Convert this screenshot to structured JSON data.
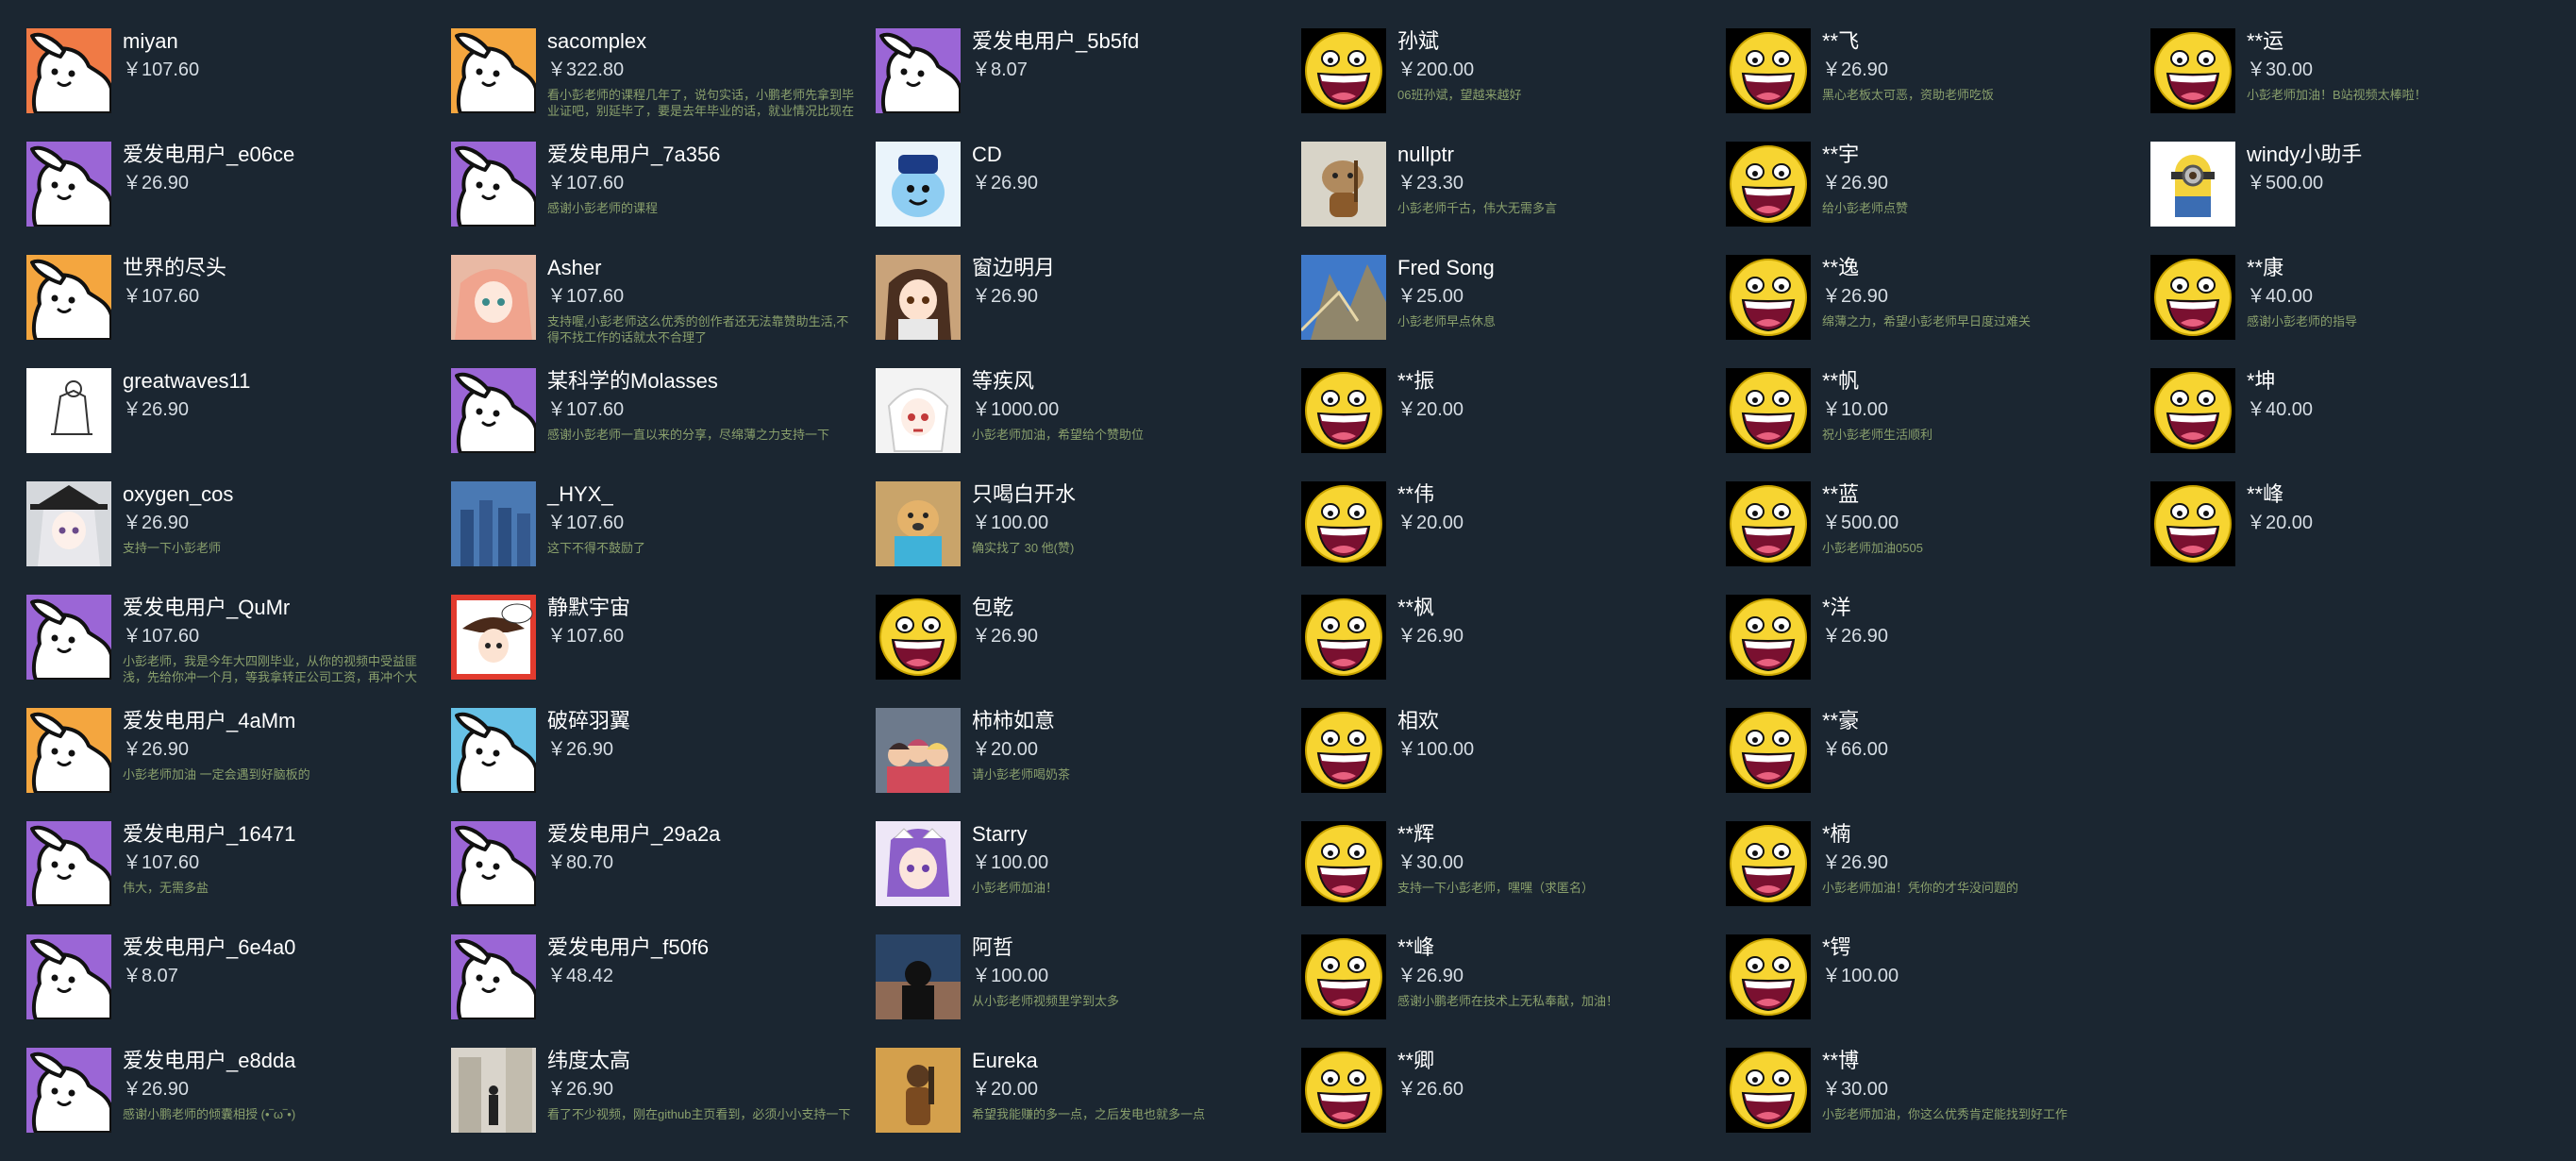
{
  "colors": {
    "background": "#1b2631",
    "name": "#ffffff",
    "amount": "#d6dde4",
    "message": "#8aa06c",
    "bunny_purple": "#9b66d6",
    "bunny_orange": "#f4a63f",
    "bunny_coral": "#f07a45",
    "bunny_sky": "#67c1e6",
    "smiley_yellow": "#f7d531"
  },
  "columns": [
    [
      {
        "name": "miyan",
        "amount": "￥107.60",
        "message": "",
        "avatar": "bunny-icon",
        "bg": "#f07a45"
      },
      {
        "name": "爱发电用户_e06ce",
        "amount": "￥26.90",
        "message": "",
        "avatar": "bunny-icon",
        "bg": "#9b66d6"
      },
      {
        "name": "世界的尽头",
        "amount": "￥107.60",
        "message": "",
        "avatar": "bunny-icon",
        "bg": "#f4a63f"
      },
      {
        "name": "greatwaves11",
        "amount": "￥26.90",
        "message": "",
        "avatar": "sketch-photo",
        "bg": "#ffffff"
      },
      {
        "name": "oxygen_cos",
        "amount": "￥26.90",
        "message": "支持一下小彭老师",
        "avatar": "anime-girl-photo",
        "bg": "#d5d8dc"
      },
      {
        "name": "爱发电用户_QuMr",
        "amount": "￥107.60",
        "message": "小彭老师，我是今年大四刚毕业，从你的视频中受益匪浅，先给你冲一个月，等我拿转正公司工资，再冲个大的！",
        "avatar": "bunny-icon",
        "bg": "#9b66d6"
      },
      {
        "name": "爱发电用户_4aMm",
        "amount": "￥26.90",
        "message": "小彭老师加油 一定会遇到好脑板的 ",
        "avatar": "bunny-icon",
        "bg": "#f4a63f"
      },
      {
        "name": "爱发电用户_16471",
        "amount": "￥107.60",
        "message": "伟大，无需多盐",
        "avatar": "bunny-icon",
        "bg": "#9b66d6"
      },
      {
        "name": "爱发电用户_6e4a0",
        "amount": "￥8.07",
        "message": "",
        "avatar": "bunny-icon",
        "bg": "#9b66d6"
      },
      {
        "name": "爱发电用户_e8dda",
        "amount": "￥26.90",
        "message": "感谢小鹏老师的倾囊相授 (•‾ω‾•)",
        "avatar": "bunny-icon",
        "bg": "#9b66d6"
      }
    ],
    [
      {
        "name": "sacomplex",
        "amount": "￥322.80",
        "message": "看小彭老师的课程几年了，说句实话，小鹏老师先拿到毕业证吧，别延毕了，要是去年毕业的话，就业情况比现在好很多了",
        "avatar": "bunny-icon",
        "bg": "#f4a63f"
      },
      {
        "name": "爱发电用户_7a356",
        "amount": "￥107.60",
        "message": "感谢小彭老师的课程",
        "avatar": "bunny-icon",
        "bg": "#9b66d6"
      },
      {
        "name": "Asher",
        "amount": "￥107.60",
        "message": "支持喔,小彭老师这么优秀的创作者还无法靠赞助生活,不得不找工作的话就太不合理了",
        "avatar": "anime-pink-photo",
        "bg": "#e9b9a4"
      },
      {
        "name": "某科学的Molasses",
        "amount": "￥107.60",
        "message": "感谢小彭老师一直以来的分享，尽绵薄之力支持一下",
        "avatar": "bunny-icon",
        "bg": "#9b66d6"
      },
      {
        "name": "_HYX_",
        "amount": "￥107.60",
        "message": "这下不得不鼓励了",
        "avatar": "blue-figures-photo",
        "bg": "#4a79b3"
      },
      {
        "name": "静默宇宙",
        "amount": "￥107.60",
        "message": "",
        "avatar": "girl-hat-photo",
        "bg": "#e23b2e"
      },
      {
        "name": "破碎羽翼",
        "amount": "￥26.90",
        "message": "",
        "avatar": "bunny-icon",
        "bg": "#67c1e6"
      },
      {
        "name": "爱发电用户_29a2a",
        "amount": "￥80.70",
        "message": "",
        "avatar": "bunny-icon",
        "bg": "#9b66d6"
      },
      {
        "name": "爱发电用户_f50f6",
        "amount": "￥48.42",
        "message": "",
        "avatar": "bunny-icon",
        "bg": "#9b66d6"
      },
      {
        "name": "纬度太高",
        "amount": "￥26.90",
        "message": "看了不少视频，刚在github主页看到，必须小小支持一下",
        "avatar": "street-photo",
        "bg": "#d9d4cb"
      }
    ],
    [
      {
        "name": "爱发电用户_5b5fd",
        "amount": "￥8.07",
        "message": "",
        "avatar": "bunny-icon",
        "bg": "#9b66d6"
      },
      {
        "name": "CD",
        "amount": "￥26.90",
        "message": "",
        "avatar": "mascot-photo",
        "bg": "#eaf4fb"
      },
      {
        "name": "窗边明月",
        "amount": "￥26.90",
        "message": "",
        "avatar": "anime-brown-photo",
        "bg": "#c9a37a"
      },
      {
        "name": "等疾风",
        "amount": "￥1000.00",
        "message": "小彭老师加油，希望给个赞助位",
        "avatar": "white-hair-photo",
        "bg": "#f3f3f3"
      },
      {
        "name": "只喝白开水",
        "amount": "￥100.00",
        "message": "确实找了 30 他(赞)",
        "avatar": "dog-photo",
        "bg": "#c9a46a"
      },
      {
        "name": "包乾",
        "amount": "￥26.90",
        "message": "",
        "avatar": "smiley-icon",
        "bg": "#000000"
      },
      {
        "name": "柿柿如意",
        "amount": "￥20.00",
        "message": "请小彭老师喝奶茶",
        "avatar": "group-anime-photo",
        "bg": "#6d7a8c"
      },
      {
        "name": "Starry",
        "amount": "￥100.00",
        "message": "小彭老师加油！",
        "avatar": "purple-girl-photo",
        "bg": "#eee7f7"
      },
      {
        "name": "阿哲",
        "amount": "￥100.00",
        "message": "从小彭老师视频里学到太多",
        "avatar": "sunset-photo",
        "bg": "#2a4466"
      },
      {
        "name": "Eureka",
        "amount": "￥20.00",
        "message": "希望我能赚的多一点，之后发电也就多一点",
        "avatar": "gold-figure-photo",
        "bg": "#d4a04c"
      }
    ],
    [
      {
        "name": "孙斌",
        "amount": "￥200.00",
        "message": "06班孙斌，望越来越好",
        "avatar": "smiley-icon",
        "bg": "#000000"
      },
      {
        "name": "nullptr",
        "amount": "￥23.30",
        "message": "小彭老师千古，伟大无需多言",
        "avatar": "cat-guitar-photo",
        "bg": "#d8d4c8"
      },
      {
        "name": "Fred Song",
        "amount": "￥25.00",
        "message": "小彭老师早点休息",
        "avatar": "tree-sky-photo",
        "bg": "#3f79c9"
      },
      {
        "name": "**振",
        "amount": "￥20.00",
        "message": "",
        "avatar": "smiley-icon",
        "bg": "#000000"
      },
      {
        "name": "**伟",
        "amount": "￥20.00",
        "message": "",
        "avatar": "smiley-icon",
        "bg": "#000000"
      },
      {
        "name": "**枫",
        "amount": "￥26.90",
        "message": "",
        "avatar": "smiley-icon",
        "bg": "#000000"
      },
      {
        "name": "相欢",
        "amount": "￥100.00",
        "message": "",
        "avatar": "smiley-icon",
        "bg": "#000000"
      },
      {
        "name": "**辉",
        "amount": "￥30.00",
        "message": "支持一下小彭老师，嘿嘿（求匿名）",
        "avatar": "smiley-icon",
        "bg": "#000000"
      },
      {
        "name": "**峰",
        "amount": "￥26.90",
        "message": "感谢小鹏老师在技术上无私奉献，加油！",
        "avatar": "smiley-icon",
        "bg": "#000000"
      },
      {
        "name": "**卿",
        "amount": "￥26.60",
        "message": "",
        "avatar": "smiley-icon",
        "bg": "#000000"
      }
    ],
    [
      {
        "name": "**飞",
        "amount": "￥26.90",
        "message": "黑心老板太可恶，资助老师吃饭",
        "avatar": "smiley-icon",
        "bg": "#000000"
      },
      {
        "name": "**宇",
        "amount": "￥26.90",
        "message": "给小彭老师点赞",
        "avatar": "smiley-icon",
        "bg": "#000000"
      },
      {
        "name": "**逸",
        "amount": "￥26.90",
        "message": "绵薄之力，希望小彭老师早日度过难关",
        "avatar": "smiley-icon",
        "bg": "#000000"
      },
      {
        "name": "**帆",
        "amount": "￥10.00",
        "message": "祝小彭老师生活顺利",
        "avatar": "smiley-icon",
        "bg": "#000000"
      },
      {
        "name": "**蓝",
        "amount": "￥500.00",
        "message": "小彭老师加油0505",
        "avatar": "smiley-icon",
        "bg": "#000000"
      },
      {
        "name": "*洋",
        "amount": "￥26.90",
        "message": "",
        "avatar": "smiley-icon",
        "bg": "#000000"
      },
      {
        "name": "**豪",
        "amount": "￥66.00",
        "message": "",
        "avatar": "smiley-icon",
        "bg": "#000000"
      },
      {
        "name": "*楠",
        "amount": "￥26.90",
        "message": "小彭老师加油！凭你的才华没问题的",
        "avatar": "smiley-icon",
        "bg": "#000000"
      },
      {
        "name": "*锷",
        "amount": "￥100.00",
        "message": "",
        "avatar": "smiley-icon",
        "bg": "#000000"
      },
      {
        "name": "**博",
        "amount": "￥30.00",
        "message": "小彭老师加油，你这么优秀肯定能找到好工作",
        "avatar": "smiley-icon",
        "bg": "#000000"
      }
    ],
    [
      {
        "name": "**运",
        "amount": "￥30.00",
        "message": "小彭老师加油！B站视频太棒啦！",
        "avatar": "smiley-icon",
        "bg": "#000000"
      },
      {
        "name": "windy小助手",
        "amount": "￥500.00",
        "message": "",
        "avatar": "minion-photo",
        "bg": "#ffffff"
      },
      {
        "name": "**康",
        "amount": "￥40.00",
        "message": "感谢小彭老师的指导",
        "avatar": "smiley-icon",
        "bg": "#000000"
      },
      {
        "name": "*坤",
        "amount": "￥40.00",
        "message": "",
        "avatar": "smiley-icon",
        "bg": "#000000"
      },
      {
        "name": "**峰",
        "amount": "￥20.00",
        "message": "",
        "avatar": "smiley-icon",
        "bg": "#000000"
      }
    ]
  ]
}
